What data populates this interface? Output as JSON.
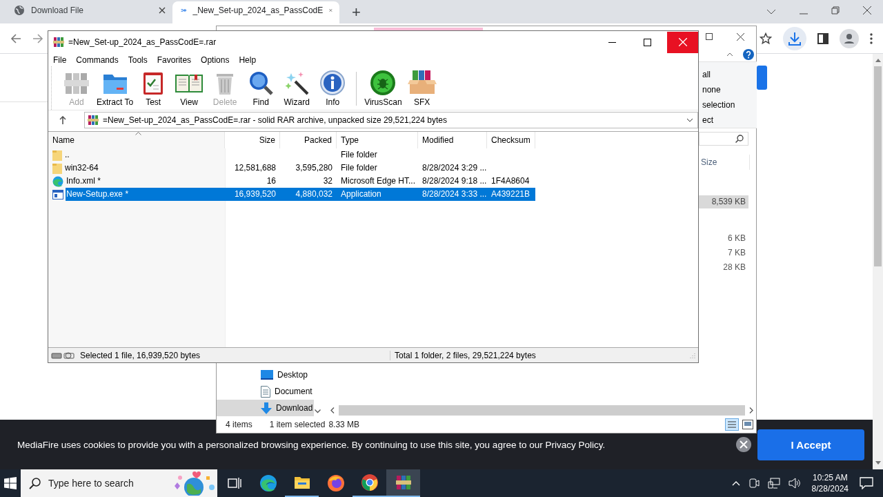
{
  "browser": {
    "tabs": [
      {
        "title": "Download File",
        "kind": "globe",
        "selected": false
      },
      {
        "title": "_New_Set-up_2024_as_PassCodE",
        "kind": "mediafire",
        "selected": true
      }
    ],
    "new_tab": "+"
  },
  "cookie_banner": {
    "text": "MediaFire uses cookies to provide you with a personalized browsing experience. By continuing to use this site, you agree to our Privacy Policy.",
    "button": "I Accept"
  },
  "explorer": {
    "ribbon_items": [
      "all",
      "none",
      "selection",
      "ect"
    ],
    "size_header": "Size",
    "rows": [
      {
        "size": "8,539 KB",
        "selected": true
      },
      {
        "size": "6 KB",
        "selected": false
      },
      {
        "size": "7 KB",
        "selected": false
      },
      {
        "size": "28 KB",
        "selected": false
      }
    ],
    "nav_items": [
      {
        "label": "Desktop",
        "kind": "desktop",
        "selected": false
      },
      {
        "label": "Document",
        "kind": "documents",
        "selected": false
      },
      {
        "label": "Download",
        "kind": "downloads",
        "selected": true
      }
    ],
    "status": {
      "items": "4 items",
      "selection": "1 item selected",
      "size": "8.33 MB"
    }
  },
  "winrar": {
    "title": "=New_Set-up_2024_as_PassCodE=.rar",
    "menu": [
      "File",
      "Commands",
      "Tools",
      "Favorites",
      "Options",
      "Help"
    ],
    "toolbar": [
      {
        "label": "Add",
        "kind": "add",
        "disabled": true
      },
      {
        "label": "Extract To",
        "kind": "extract",
        "disabled": false
      },
      {
        "label": "Test",
        "kind": "test",
        "disabled": false
      },
      {
        "label": "View",
        "kind": "view",
        "disabled": false
      },
      {
        "label": "Delete",
        "kind": "delete",
        "disabled": true
      },
      {
        "label": "Find",
        "kind": "find",
        "disabled": false
      },
      {
        "label": "Wizard",
        "kind": "wizard",
        "disabled": false
      },
      {
        "label": "Info",
        "kind": "info",
        "disabled": false
      },
      {
        "label": "VirusScan",
        "kind": "virusscan",
        "disabled": false
      },
      {
        "label": "SFX",
        "kind": "sfx",
        "disabled": false
      }
    ],
    "path": "=New_Set-up_2024_as_PassCodE=.rar - solid RAR archive, unpacked size 29,521,224 bytes",
    "columns": [
      "Name",
      "Size",
      "Packed",
      "Type",
      "Modified",
      "Checksum"
    ],
    "rows": [
      {
        "kind": "folder",
        "name": "..",
        "size": "",
        "packed": "",
        "type": "File folder",
        "modified": "",
        "checksum": "",
        "selected": false
      },
      {
        "kind": "folder",
        "name": "win32-64",
        "size": "12,581,688",
        "packed": "3,595,280",
        "type": "File folder",
        "modified": "8/28/2024 3:29 ...",
        "checksum": "",
        "selected": false
      },
      {
        "kind": "edge",
        "name": "Info.xml *",
        "size": "16",
        "packed": "32",
        "type": "Microsoft Edge HT...",
        "modified": "8/28/2024 9:18 ...",
        "checksum": "1F4A8604",
        "selected": false
      },
      {
        "kind": "exe",
        "name": "New-Setup.exe *",
        "size": "16,939,520",
        "packed": "4,880,032",
        "type": "Application",
        "modified": "8/28/2024 3:33 ...",
        "checksum": "A439221B",
        "selected": true
      }
    ],
    "status_left": "Selected 1 file, 16,939,520 bytes",
    "status_right": "Total 1 folder, 2 files, 29,521,224 bytes"
  },
  "taskbar": {
    "search_placeholder": "Type here to search",
    "apps": [
      {
        "kind": "taskview",
        "running": false,
        "selected": false
      },
      {
        "kind": "edge",
        "running": false,
        "selected": false
      },
      {
        "kind": "files",
        "running": true,
        "selected": false
      },
      {
        "kind": "firefox",
        "running": false,
        "selected": false
      },
      {
        "kind": "chrome",
        "running": true,
        "selected": false
      },
      {
        "kind": "winrar",
        "running": true,
        "selected": true
      }
    ],
    "time": "10:25 AM",
    "date": "8/28/2024"
  }
}
